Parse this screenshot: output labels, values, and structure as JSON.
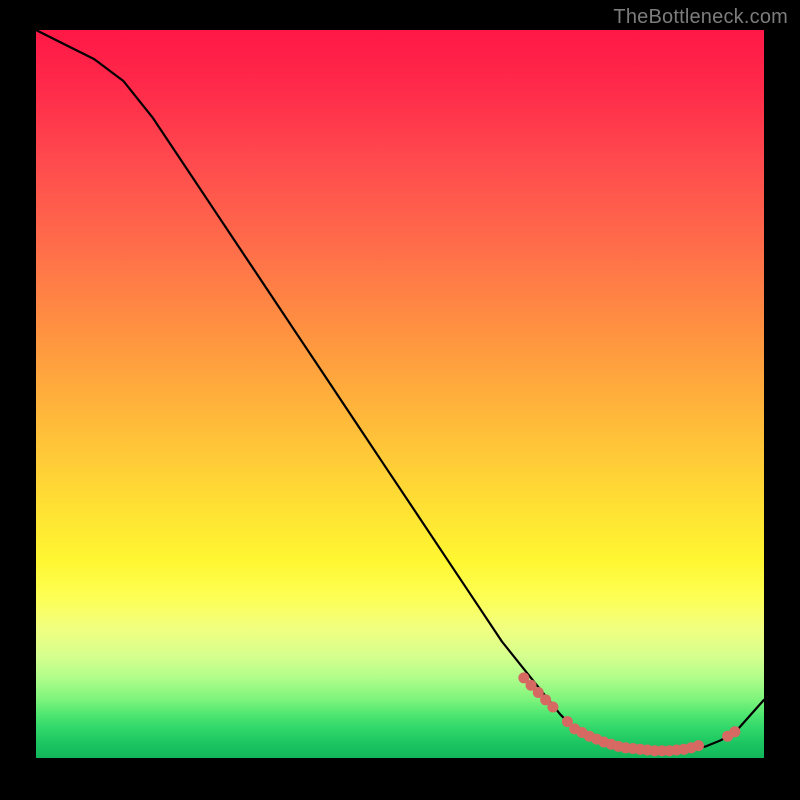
{
  "attribution": "TheBottleneck.com",
  "colors": {
    "background": "#000000",
    "curve": "#000000",
    "marker": "#d66a63",
    "attribution_text": "#7c7c7c"
  },
  "chart_data": {
    "type": "line",
    "title": "",
    "xlabel": "",
    "ylabel": "",
    "xlim": [
      0,
      100
    ],
    "ylim": [
      0,
      100
    ],
    "grid": false,
    "legend": false,
    "series": [
      {
        "name": "curve",
        "x": [
          0,
          4,
          8,
          12,
          16,
          20,
          24,
          28,
          32,
          36,
          40,
          44,
          48,
          52,
          56,
          60,
          64,
          68,
          72,
          74,
          76,
          78,
          80,
          82,
          84,
          86,
          88,
          90,
          92,
          94,
          96,
          100
        ],
        "y": [
          100,
          98,
          96,
          93,
          88,
          82,
          76,
          70,
          64,
          58,
          52,
          46,
          40,
          34,
          28,
          22,
          16,
          11,
          6,
          4,
          3,
          2,
          1.5,
          1.2,
          1.0,
          1.0,
          1.0,
          1.2,
          1.6,
          2.4,
          3.5,
          8
        ]
      }
    ],
    "markers": [
      {
        "x": 67,
        "y": 11
      },
      {
        "x": 68,
        "y": 10
      },
      {
        "x": 69,
        "y": 9
      },
      {
        "x": 70,
        "y": 8
      },
      {
        "x": 71,
        "y": 7
      },
      {
        "x": 73,
        "y": 5
      },
      {
        "x": 74,
        "y": 4
      },
      {
        "x": 75,
        "y": 3.5
      },
      {
        "x": 76,
        "y": 3
      },
      {
        "x": 77,
        "y": 2.6
      },
      {
        "x": 78,
        "y": 2.2
      },
      {
        "x": 79,
        "y": 1.9
      },
      {
        "x": 80,
        "y": 1.6
      },
      {
        "x": 81,
        "y": 1.4
      },
      {
        "x": 82,
        "y": 1.3
      },
      {
        "x": 83,
        "y": 1.2
      },
      {
        "x": 84,
        "y": 1.1
      },
      {
        "x": 85,
        "y": 1.0
      },
      {
        "x": 86,
        "y": 1.0
      },
      {
        "x": 87,
        "y": 1.0
      },
      {
        "x": 88,
        "y": 1.1
      },
      {
        "x": 89,
        "y": 1.2
      },
      {
        "x": 90,
        "y": 1.4
      },
      {
        "x": 91,
        "y": 1.7
      },
      {
        "x": 95,
        "y": 3.0
      },
      {
        "x": 96,
        "y": 3.6
      }
    ]
  }
}
